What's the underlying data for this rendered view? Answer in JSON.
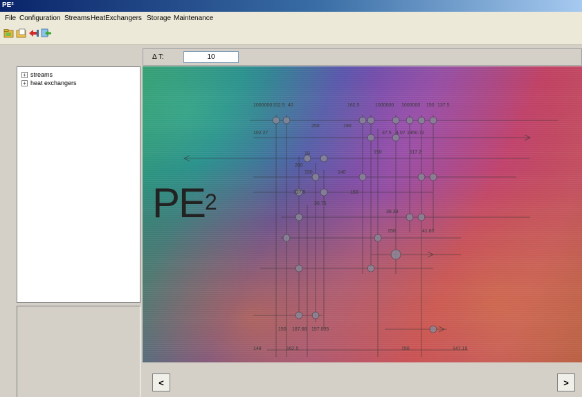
{
  "window": {
    "title": "PE²"
  },
  "menu": {
    "items": [
      {
        "label": "File"
      },
      {
        "label": "Configuration"
      },
      {
        "label": "Streams"
      },
      {
        "label": "HeatExchangers"
      },
      {
        "label": "Storage"
      },
      {
        "label": "Maintenance"
      }
    ]
  },
  "toolbar": {
    "icons": [
      "open-folder-icon",
      "open-file-icon",
      "import-icon",
      "export-icon"
    ]
  },
  "tree": {
    "items": [
      {
        "label": "streams",
        "expander": "+"
      },
      {
        "label": "heat exchangers",
        "expander": "+"
      }
    ]
  },
  "delta_t": {
    "label": "Δ T:",
    "value": "10"
  },
  "canvas": {
    "logo_text": "PE",
    "logo_superscript": "2",
    "labels": [
      "1000000",
      "152.5",
      "40",
      "162.5",
      "1000000",
      "1000000",
      "150",
      "137.5",
      "250",
      "190",
      "37.5",
      "4.07",
      "102.27",
      "1950.72",
      "19",
      "150",
      "117.2",
      "200",
      "150",
      "140",
      "127.5",
      "150",
      "30.76",
      "38.39",
      "150",
      "41.67",
      "150",
      "187.68",
      "157.005",
      "148",
      "162.5",
      "150",
      "147.15"
    ]
  },
  "navigation": {
    "prev_label": "<",
    "next_label": ">"
  }
}
